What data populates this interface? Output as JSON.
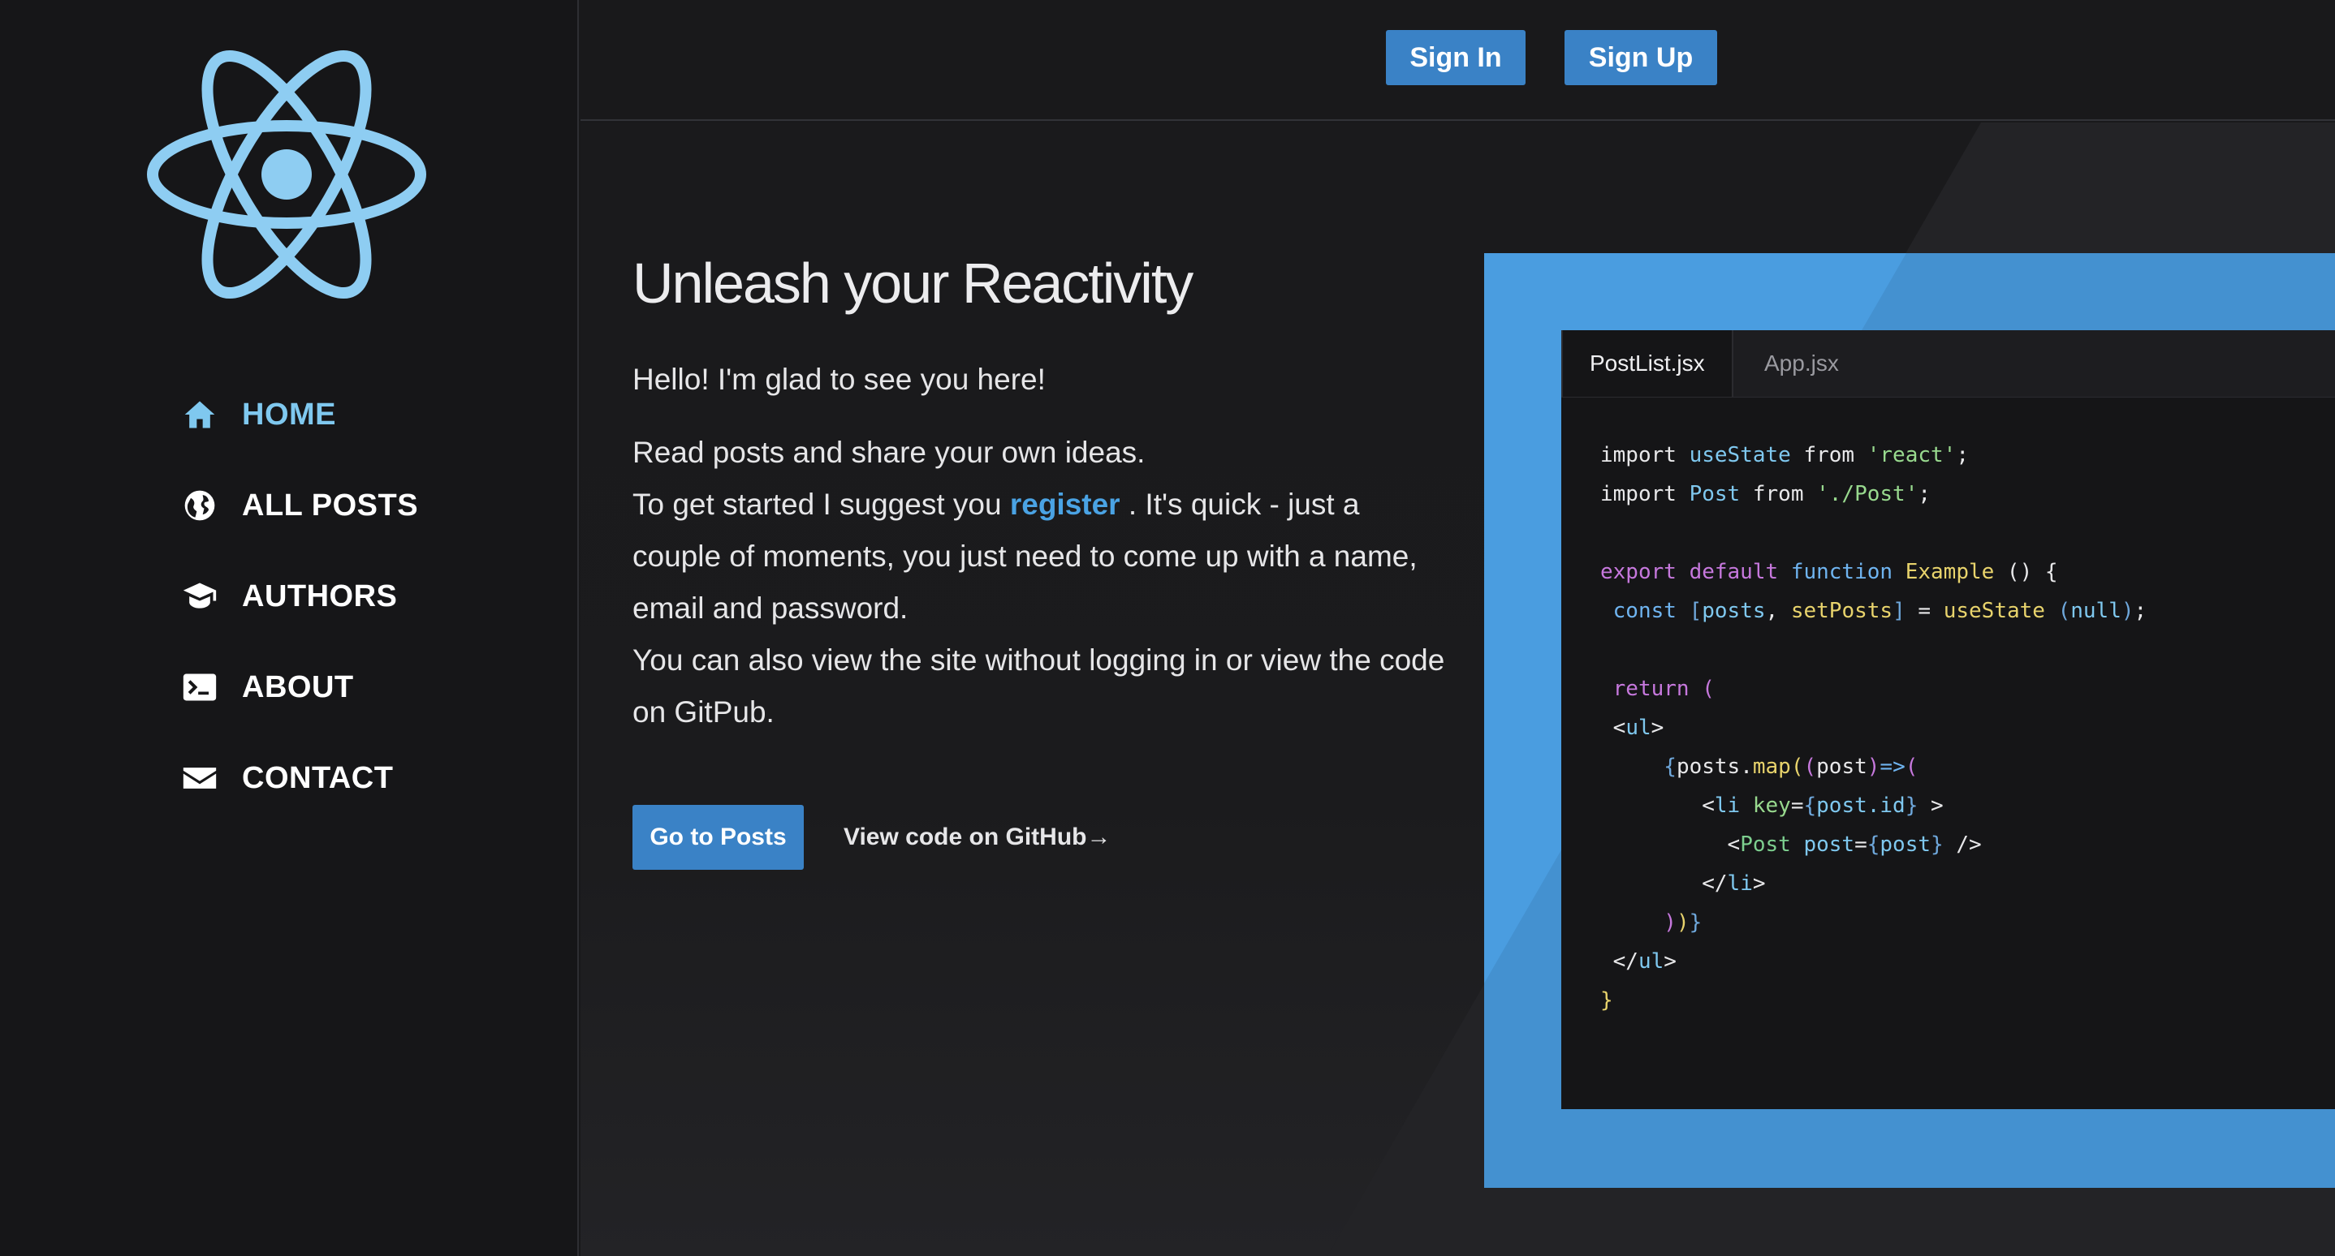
{
  "colors": {
    "accent": "#3a82c6",
    "link": "#4aa3e4",
    "active_nav": "#7fc8ef",
    "logo": "#8ecdf2",
    "frame": "#4a9de0"
  },
  "header": {
    "sign_in": "Sign In",
    "sign_up": "Sign Up"
  },
  "sidebar": {
    "logo_icon": "react-atom-logo",
    "items": [
      {
        "label": "HOME",
        "icon": "home-icon",
        "active": true
      },
      {
        "label": "ALL POSTS",
        "icon": "globe-icon",
        "active": false
      },
      {
        "label": "AUTHORS",
        "icon": "graduation-cap-icon",
        "active": false
      },
      {
        "label": "ABOUT",
        "icon": "terminal-icon",
        "active": false
      },
      {
        "label": "CONTACT",
        "icon": "envelope-icon",
        "active": false
      }
    ]
  },
  "hero": {
    "title": "Unleash your Reactivity",
    "greeting": "Hello! I'm glad to see you here!",
    "line1": "Read posts and share your own ideas.",
    "line2_before": "To get started I suggest you ",
    "register_link": "register",
    "line2_after": " . It's quick - just a couple of moments, you just need to come up with a name, email and password.",
    "line3": "You can also view the site without logging in or view the code on GitPub.",
    "go_button": "Go to Posts",
    "github_link": "View code on GitHub→"
  },
  "code_window": {
    "tabs": [
      "PostList.jsx",
      "App.jsx"
    ],
    "active_tab": "PostList.jsx",
    "lines": [
      "import useState from 'react';",
      "import Post from './Post';",
      "",
      "export default function Example () {",
      " const [posts, setPosts] = useState (null);",
      "",
      " return (",
      " <ul>",
      "     {posts.map((post)=>(",
      "        <li key={post.id} >",
      "          <Post post={post} />",
      "        </li>",
      "     ))}",
      " </ul>",
      "}"
    ]
  }
}
